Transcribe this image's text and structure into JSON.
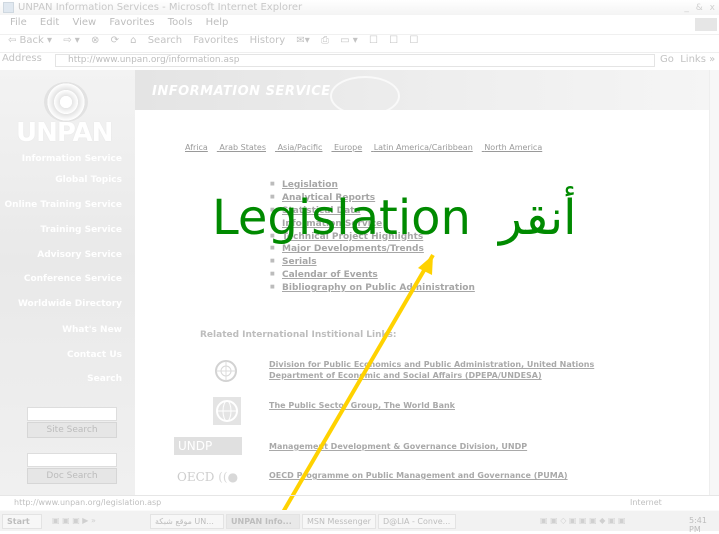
{
  "window": {
    "title": "UNPAN Information Services - Microsoft Internet Explorer",
    "controls": "_ & x"
  },
  "menu": [
    "File",
    "Edit",
    "View",
    "Favorites",
    "Tools",
    "Help"
  ],
  "toolbar": [
    "⇦ Back ▾",
    "⇨ ▾",
    "⊗",
    "⟳",
    "⌂",
    "Search",
    "Favorites",
    "History",
    "✉▾",
    "⎙",
    "▭ ▾",
    "☐",
    "☐",
    "☐"
  ],
  "address": {
    "label": "Address",
    "url": "http://www.unpan.org/information.asp",
    "go": "Go",
    "links": "Links »"
  },
  "site": {
    "logo_text": "UNPAN",
    "banner_title": "INFORMATION SERVICE",
    "nav": [
      "Information Service",
      "Global Topics",
      "Online Training Service",
      "Training Service",
      "Advisory Service",
      "Conference Service",
      "Worldwide Directory",
      "What's New",
      "Contact Us",
      "Search"
    ],
    "site_search_button": "Site Search",
    "doc_search_button": "Doc Search",
    "regions": [
      "Africa",
      "Arab States",
      "Asia/Pacific",
      "Europe",
      "Latin America/Caribbean",
      "North America"
    ],
    "resources": [
      "Legislation",
      "Analytical Reports",
      "Statistical Data",
      "Information Service",
      "Technical Project Highlights",
      "Major Developments/Trends",
      "Serials",
      "Calendar of Events",
      "Bibliography on Public Administration"
    ],
    "related_heading": "Related International Institional Links:",
    "links": [
      {
        "text": "Division for Public Economics and Public Administration, United Nations",
        "text2": "Department of Economic and Social Affairs (DPEPA/UNDESA)",
        "icon": "un-emblem-icon"
      },
      {
        "text": "The Public Sector Group, The World Bank",
        "icon": "world-bank-globe-icon"
      },
      {
        "text": "Management Development & Governance Division, UNDP",
        "icon": "undp-logo-icon"
      },
      {
        "text": "OECD Programme on Public Management and Governance (PUMA)",
        "icon": "oecd-logo-icon"
      }
    ],
    "undp_logo": "UNDP",
    "oecd_logo": "OECD"
  },
  "overlay": {
    "label": "Legislation",
    "arabic": "أنقر",
    "color": "#008a00",
    "arrow_color": "#ffd700"
  },
  "status": {
    "url": "http://www.unpan.org/legislation.asp",
    "zone": "Internet"
  },
  "taskbar": {
    "start": "Start",
    "buttons": [
      "موقع شبكة UN...",
      "UNPAN Info...",
      "MSN Messenger",
      "D@LIA - Conve..."
    ],
    "clock": "5:41 PM"
  }
}
